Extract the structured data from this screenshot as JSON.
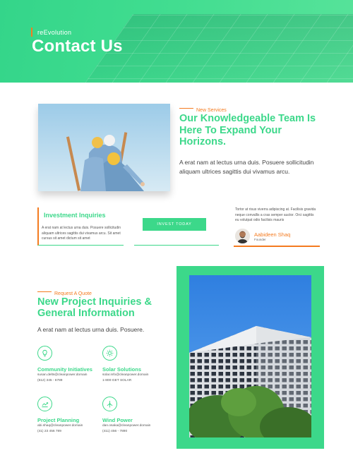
{
  "hero": {
    "eyebrow": "reEvolution",
    "title": "Contact Us"
  },
  "services": {
    "eyebrow": "New Services",
    "title": "Our Knowledgeable Team Is Here To Expand Your Horizons.",
    "text": "A erat nam at lectus urna duis. Posuere sollicitudin aliquam ultrices sagittis dui vivamus arcu."
  },
  "investment": {
    "title": "Investment Inquiries",
    "text": "A erat nam at lectus urna duis. Posuere sollicitudin aliquam ultrices sagittis dui vivamus arcu. Sit amet cursus sit amet dictum sit amet",
    "button_label": "INVEST TODAY"
  },
  "testimonial": {
    "quote": "Tortor at risus viverra adipiscing at. Facilisis gravida neque convallis a cras semper auctor. Orci sagittis eu volutpat odio facilisis mauris",
    "name": "Aabideen Shaq",
    "role": "Founder"
  },
  "quote_section": {
    "eyebrow": "Request A Quote",
    "title": "New Project Inquiries & General Information",
    "text": "A erat nam at lectus urna duis. Posuere."
  },
  "features": [
    {
      "icon": "lightbulb-icon",
      "title": "Community Initiatives",
      "email": "susan.delts@cleanpower.domain",
      "phone": "(612) 345 - 6789"
    },
    {
      "icon": "sun-icon",
      "title": "Solar Solutions",
      "email": "solar.info@cleanpower.domain",
      "phone": "1-800-GET SOLAR"
    },
    {
      "icon": "chart-growth-icon",
      "title": "Project Planning",
      "email": "abi.shaq@cleanpower.domain",
      "phone": "(41) 23 456 789"
    },
    {
      "icon": "wind-icon",
      "title": "Wind Power",
      "email": "dan.osaka@cleanpower.domain",
      "phone": "(411) 456 - 7890"
    }
  ],
  "colors": {
    "accent_green": "#3cd88a",
    "accent_orange": "#f47b20"
  }
}
